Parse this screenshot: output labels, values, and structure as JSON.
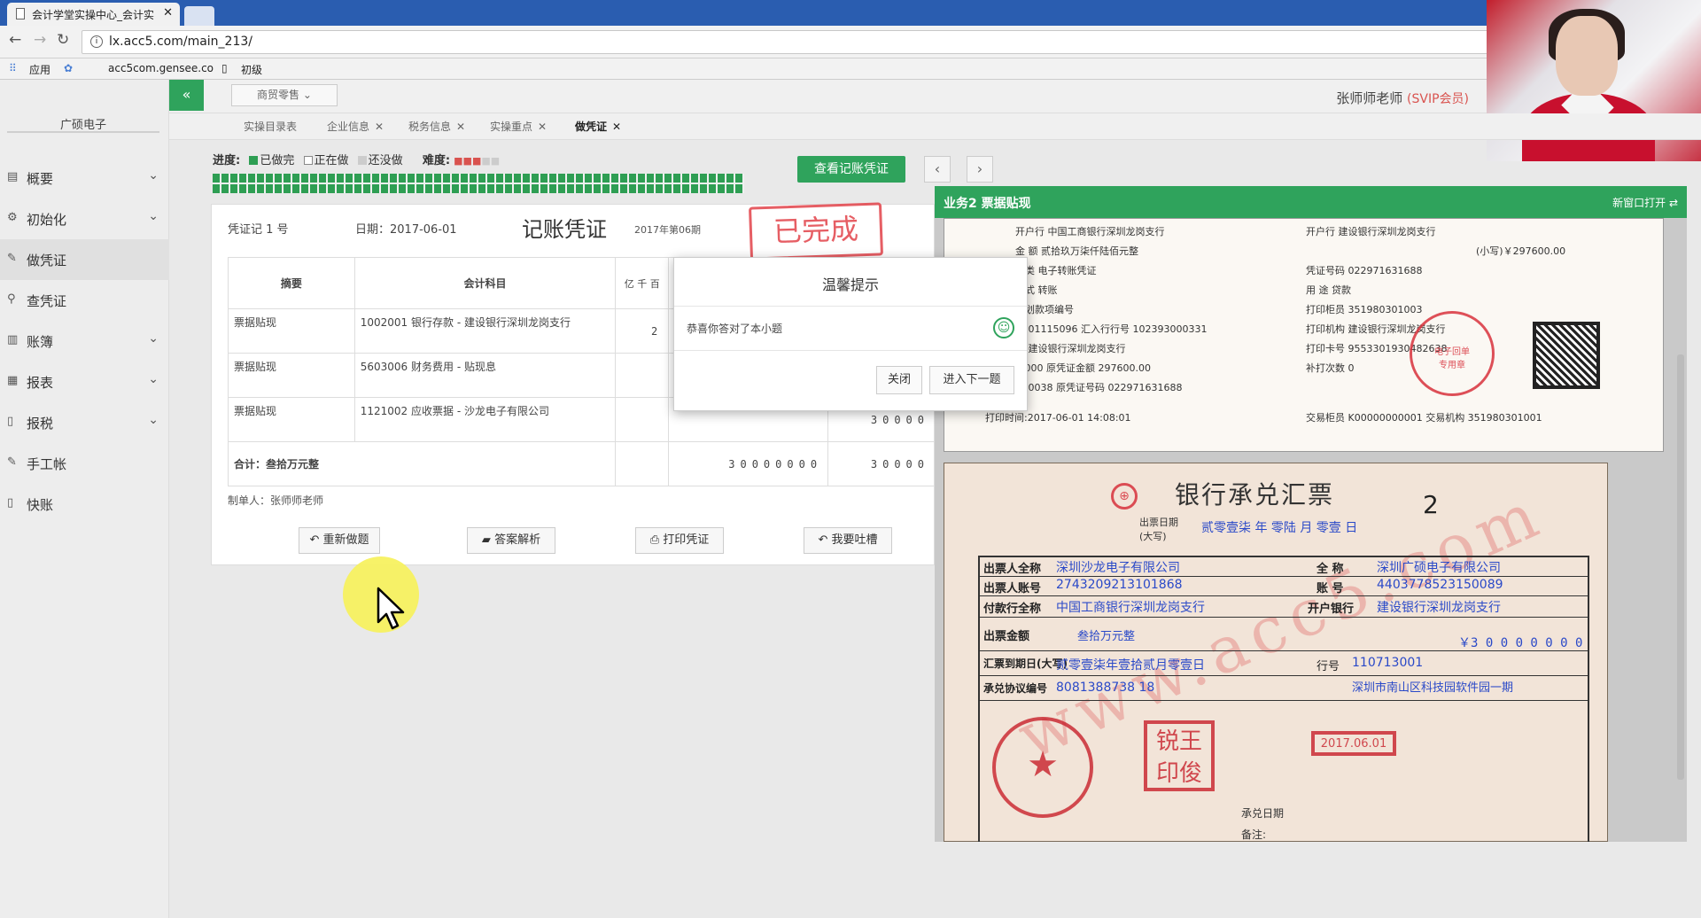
{
  "browser": {
    "tab_title": "会计学堂实操中心_会计实",
    "url": "lx.acc5.com/main_213/",
    "bookmarks": [
      "应用",
      "acc5com.gensee.co",
      "初级"
    ]
  },
  "sidebar": {
    "brand": "广硕电子",
    "items": [
      {
        "label": "概要",
        "icon": "list-icon"
      },
      {
        "label": "初始化",
        "icon": "gear-icon"
      },
      {
        "label": "做凭证",
        "icon": "pen-icon"
      },
      {
        "label": "查凭证",
        "icon": "search-icon"
      },
      {
        "label": "账簿",
        "icon": "book-icon"
      },
      {
        "label": "报表",
        "icon": "table-icon"
      },
      {
        "label": "报税",
        "icon": "doc-icon"
      },
      {
        "label": "手工帐",
        "icon": "pen-icon"
      },
      {
        "label": "快账",
        "icon": "doc-icon"
      }
    ]
  },
  "topbar": {
    "dropdown": "商贸零售",
    "user_name": "张师师老师",
    "user_level": "(SVIP会员)"
  },
  "tabs": [
    {
      "label": "实操目录表"
    },
    {
      "label": "企业信息"
    },
    {
      "label": "税务信息"
    },
    {
      "label": "实操重点"
    },
    {
      "label": "做凭证"
    }
  ],
  "progress": {
    "label": "进度:",
    "done": "已做完",
    "doing": "正在做",
    "todo": "还没做",
    "difficulty": "难度:"
  },
  "buttons": {
    "view_voucher": "查看记账凭证",
    "prev": "‹",
    "next": "›",
    "redo": "重新做题",
    "analysis": "答案解析",
    "print": "打印凭证",
    "complain": "我要吐槽"
  },
  "voucher": {
    "number": "凭证记 1 号",
    "date": "日期：2017-06-01",
    "title": "记账凭证",
    "period": "2017年第06期",
    "stamp": "已完成",
    "col_summary": "摘要",
    "col_account": "会计科目",
    "col_digits": "亿 千 百",
    "rows": [
      {
        "summary": "票据贴现",
        "account": "1002001 银行存款 - 建设银行深圳龙岗支行",
        "debit": "2",
        "credit": ""
      },
      {
        "summary": "票据贴现",
        "account": "5603006 财务费用 - 贴现息",
        "debit": "",
        "credit": ""
      },
      {
        "summary": "票据贴现",
        "account": "1121002 应收票据 - 沙龙电子有限公司",
        "debit": "",
        "credit": "30000"
      }
    ],
    "total_label": "合计：叁拾万元整",
    "total_debit": "30000000",
    "total_credit": "30000",
    "maker": "制单人：张师师老师"
  },
  "right_panel": {
    "title": "业务2 票据贴现",
    "open_new": "新窗口打开",
    "receipt_lines": [
      "开户行 中国工商银行深圳龙岗支行",
      "开户行 建设银行深圳龙岗支行",
      "金 额 贰拾玖万柒仟陆佰元整",
      "(小写)￥297600.00",
      "种类 电子转账凭证",
      "凭证号码 022971631688",
      "方式 转账",
      "用 途 贷款",
      "汇划款项编号",
      "打印柜员 351980301003",
      "号 01115096 汇入行行号 102393000331",
      "打印机构 建设银行深圳龙岗支行",
      "名 建设银行深圳龙岗支行",
      "打印卡号 9553301930482638",
      "0.000 原凭证金额 297600.00",
      "补打次数 0",
      "类 0038 原凭证号码 022971631688",
      "打印时间:2017-06-01 14:08:01",
      "交易柜员 K00000000001 交易机构 351980301001"
    ],
    "bill_title": "银行承兑汇票",
    "bill_no": "2",
    "issue_date_label": "出票日期(大写)",
    "issue_date": "贰零壹柒 年 零陆 月 零壹 日",
    "drawer_name_label": "出票人全称",
    "drawer_name": "深圳沙龙电子有限公司",
    "drawer_account_label": "出票人账号",
    "drawer_account": "2743209213101868",
    "drawer_bank_label": "付款行全称",
    "drawer_bank": "中国工商银行深圳龙岗支行",
    "payee_name_label": "全 称",
    "payee_name": "深圳广硕电子有限公司",
    "payee_account_label": "账 号",
    "payee_account": "4403778523150089",
    "payee_bank_label": "开户银行",
    "payee_bank": "建设银行深圳龙岗支行",
    "amount_label": "出票金额",
    "amount_cn": "叁拾万元整",
    "amount_digits": "￥3 0 0 0 0 0 0 0",
    "due_label": "汇票到期日(大写)",
    "due": "贰零壹柒年壹拾贰月零壹日",
    "bank_no_label": "行号",
    "bank_no": "110713001",
    "agreement_label": "承兑协议编号",
    "agreement": "8081388738 18",
    "address": "深圳市南山区科技园软件园一期",
    "stamp_date": "2017.06.01",
    "seal_name": "锐王 印俊",
    "accept_date": "承兑日期",
    "note": "备注:"
  },
  "modal": {
    "title": "温馨提示",
    "message": "恭喜你答对了本小题",
    "close": "关闭",
    "next": "进入下一题"
  }
}
